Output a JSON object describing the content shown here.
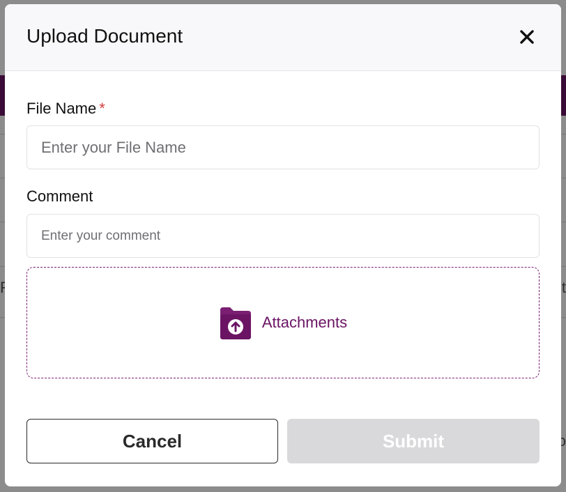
{
  "modal": {
    "title": "Upload Document",
    "close_icon": "close-icon"
  },
  "form": {
    "file_name": {
      "label": "File Name",
      "required_marker": "*",
      "placeholder": "Enter your File Name",
      "value": ""
    },
    "comment": {
      "label": "Comment",
      "placeholder": "Enter your comment",
      "value": ""
    },
    "attachments": {
      "label": "Attachments",
      "icon": "folder-upload-icon"
    }
  },
  "actions": {
    "cancel_label": "Cancel",
    "submit_label": "Submit",
    "submit_disabled": true
  },
  "background": {
    "left_fragment": "F",
    "right_fragment": "t",
    "right_fragment_2": "o"
  },
  "colors": {
    "brand_purple": "#6b1464",
    "required_red": "#d23c3c",
    "disabled_button": "#d9d9db"
  }
}
